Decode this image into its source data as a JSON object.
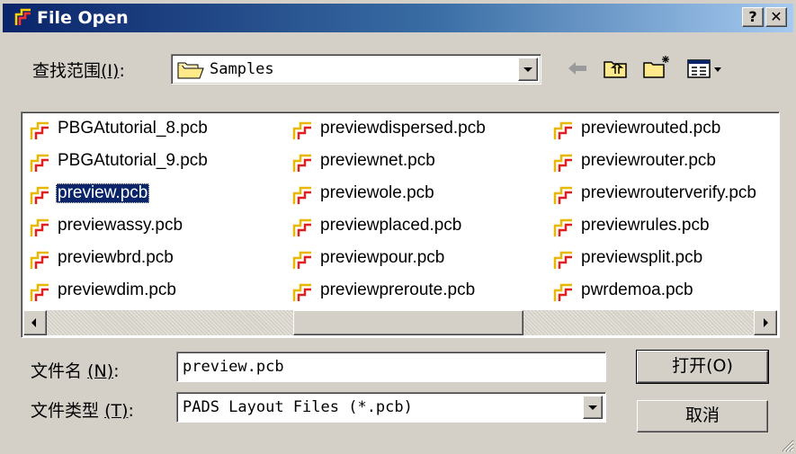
{
  "window": {
    "title": "File Open",
    "help_button": "?",
    "close_button": "✕"
  },
  "lookin": {
    "label": "查找范围",
    "hotkey": "(I)",
    "colon": ":",
    "value": "Samples"
  },
  "toolbar": {
    "back_icon": "back-arrow-icon",
    "up_icon": "up-folder-icon",
    "new_folder_icon": "new-folder-icon",
    "view_menu_icon": "view-menu-icon"
  },
  "files": [
    {
      "name": "PBGAtutorial_8.pcb"
    },
    {
      "name": "PBGAtutorial_9.pcb"
    },
    {
      "name": "preview.pcb",
      "selected": true
    },
    {
      "name": "previewassy.pcb"
    },
    {
      "name": "previewbrd.pcb"
    },
    {
      "name": "previewdim.pcb"
    },
    {
      "name": "previewdispersed.pcb"
    },
    {
      "name": "previewnet.pcb"
    },
    {
      "name": "previewole.pcb"
    },
    {
      "name": "previewplaced.pcb"
    },
    {
      "name": "previewpour.pcb"
    },
    {
      "name": "previewpreroute.pcb"
    },
    {
      "name": "previewrouted.pcb"
    },
    {
      "name": "previewrouter.pcb"
    },
    {
      "name": "previewrouterverify.pcb"
    },
    {
      "name": "previewrules.pcb"
    },
    {
      "name": "previewsplit.pcb"
    },
    {
      "name": "pwrdemoa.pcb"
    }
  ],
  "filename": {
    "label": "文件名",
    "hotkey": "(N)",
    "colon": ":",
    "value": "preview.pcb"
  },
  "filetype": {
    "label": "文件类型",
    "hotkey": "(T)",
    "colon": ":",
    "value": "PADS Layout Files (*.pcb)"
  },
  "buttons": {
    "open": "打开(O)",
    "cancel": "取消"
  },
  "colors": {
    "title_bar_start": "#0a246a",
    "title_bar_end": "#a6caf0",
    "dialog_face": "#d4d0c8",
    "selection": "#0a246a"
  }
}
